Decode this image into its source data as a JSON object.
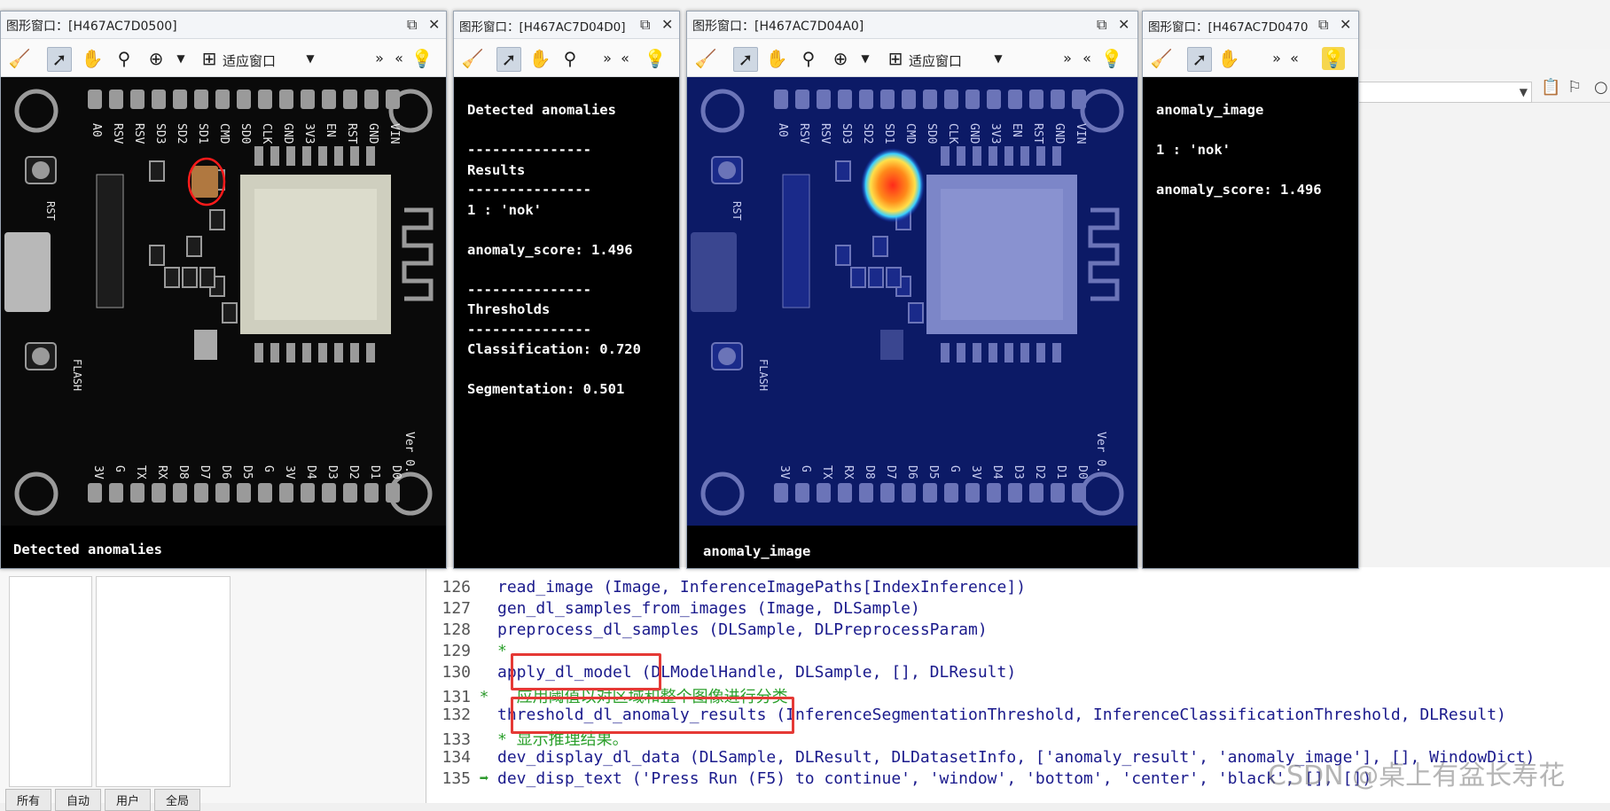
{
  "windows": [
    {
      "title": "图形窗口：[H467AC7D0500]",
      "fit_label": "适应窗口",
      "canvas_text": "Detected anomalies"
    },
    {
      "title": "图形窗口：[H467AC7D04D0]",
      "lines": [
        "Detected anomalies",
        "---------------",
        "Results",
        "---------------",
        "1 : 'nok'",
        "anomaly_score: 1.496",
        "---------------",
        "Thresholds",
        "---------------",
        "Classification: 0.720",
        "Segmentation: 0.501"
      ]
    },
    {
      "title": "图形窗口：[H467AC7D04A0]",
      "fit_label": "适应窗口",
      "canvas_text": "anomaly_image"
    },
    {
      "title": "图形窗口：[H467AC7D0470",
      "lines": [
        "anomaly_image",
        "1 : 'nok'",
        "anomaly_score: 1.496"
      ]
    }
  ],
  "pcb_labels": {
    "top": [
      "A0",
      "RSV",
      "RSV",
      "SD3",
      "SD2",
      "SD1",
      "CMD",
      "SD0",
      "CLK",
      "GND",
      "3V3",
      "EN",
      "RST",
      "GND",
      "VIN"
    ],
    "bottom": [
      "D0",
      "D1",
      "D2",
      "D3",
      "D4",
      "3V",
      "G",
      "D5",
      "D6",
      "D7",
      "D8",
      "RX",
      "TX",
      "G",
      "3V"
    ],
    "side": [
      "RST",
      "FLASH",
      "Ver 0."
    ]
  },
  "ide": {
    "tabs": [
      "所有",
      "自动",
      "用户",
      "全局"
    ],
    "code": [
      {
        "ln": "126",
        "marker": "",
        "text": "read_image (Image, InferenceImagePaths[IndexInference])",
        "kind": "code"
      },
      {
        "ln": "127",
        "marker": "",
        "text": "gen_dl_samples_from_images (Image, DLSample)",
        "kind": "code"
      },
      {
        "ln": "128",
        "marker": "",
        "text": "preprocess_dl_samples (DLSample, DLPreprocessParam)",
        "kind": "code"
      },
      {
        "ln": "129",
        "marker": "",
        "text": "*",
        "kind": "comment"
      },
      {
        "ln": "130",
        "marker": "",
        "text": "apply_dl_model (DLModelHandle, DLSample, [], DLResult)",
        "kind": "code"
      },
      {
        "ln": "131",
        "marker": "*",
        "text": "  应用阈值以对区域和整个图像进行分类",
        "kind": "comment"
      },
      {
        "ln": "132",
        "marker": "",
        "text": "threshold_dl_anomaly_results (InferenceSegmentationThreshold, InferenceClassificationThreshold, DLResult)",
        "kind": "code"
      },
      {
        "ln": "133",
        "marker": "",
        "text": "* 显示推理结果。",
        "kind": "comment"
      },
      {
        "ln": "134",
        "marker": "",
        "text": "dev_display_dl_data (DLSample, DLResult, DLDatasetInfo, ['anomaly_result', 'anomaly_image'], [], WindowDict)",
        "kind": "code"
      },
      {
        "ln": "135",
        "marker": "➡",
        "text": "dev_disp_text ('Press Run (F5) to continue', 'window', 'bottom', 'center', 'black', [], [])",
        "kind": "code"
      }
    ],
    "watermark": "CSDN @桌上有盆长寿花"
  },
  "colors": {
    "highlight_box": "#e53935",
    "heat": "#ff3b1f",
    "comment": "#2ca02c",
    "code": "#1a1a8c"
  }
}
